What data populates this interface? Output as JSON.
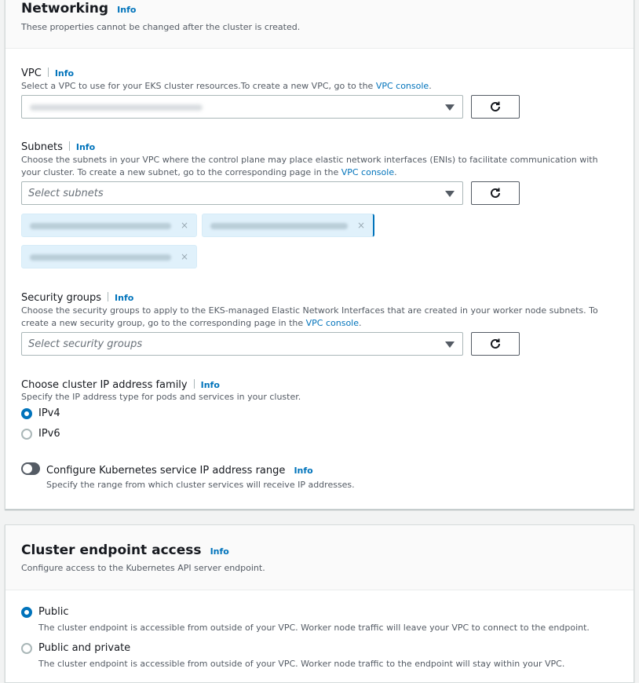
{
  "colors": {
    "link": "#0073bb",
    "text": "#16191f",
    "muted": "#545b64"
  },
  "networking": {
    "title": "Networking",
    "info": "Info",
    "subtitle": "These properties cannot be changed after the cluster is created."
  },
  "vpc": {
    "label": "VPC",
    "info": "Info",
    "desc": "Select a VPC to use for your EKS cluster resources.To create a new VPC, go to the ",
    "desc_link": "VPC console",
    "desc_end": ".",
    "refresh_icon": "refresh-icon"
  },
  "subnets": {
    "label": "Subnets",
    "info": "Info",
    "desc": "Choose the subnets in your VPC where the control plane may place elastic network interfaces (ENIs) to facilitate communication with your cluster. To create a new subnet, go to the corresponding page in the ",
    "desc_link": "VPC console",
    "desc_end": ".",
    "placeholder": "Select subnets",
    "token_remove": "×"
  },
  "security_groups": {
    "label": "Security groups",
    "info": "Info",
    "desc": "Choose the security groups to apply to the EKS-managed Elastic Network Interfaces that are created in your worker node subnets. To create a new security group, go to the corresponding page in the ",
    "desc_link": "VPC console",
    "desc_end": ".",
    "placeholder": "Select security groups"
  },
  "ip_family": {
    "label": "Choose cluster IP address family",
    "info": "Info",
    "desc": "Specify the IP address type for pods and services in your cluster.",
    "options": [
      "IPv4",
      "IPv6"
    ],
    "selected": "IPv4"
  },
  "service_range": {
    "label": "Configure Kubernetes service IP address range",
    "info": "Info",
    "desc": "Specify the range from which cluster services will receive IP addresses."
  },
  "endpoint": {
    "title": "Cluster endpoint access",
    "info": "Info",
    "subtitle": "Configure access to the Kubernetes API server endpoint.",
    "options": [
      {
        "label": "Public",
        "desc": "The cluster endpoint is accessible from outside of your VPC. Worker node traffic will leave your VPC to connect to the endpoint."
      },
      {
        "label": "Public and private",
        "desc": "The cluster endpoint is accessible from outside of your VPC. Worker node traffic to the endpoint will stay within your VPC."
      }
    ],
    "selected": "Public"
  }
}
